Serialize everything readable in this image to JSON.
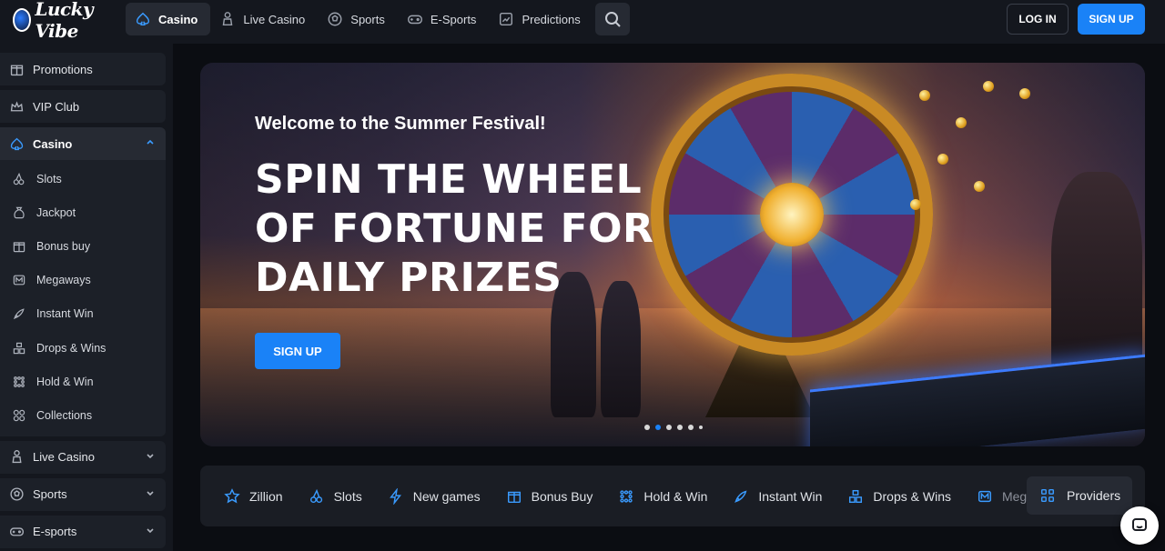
{
  "brand": {
    "logo_text": "Lucky Vibe"
  },
  "nav": {
    "items": [
      {
        "label": "Casino",
        "icon": "spade-icon",
        "active": true
      },
      {
        "label": "Live Casino",
        "icon": "dealer-icon",
        "active": false
      },
      {
        "label": "Sports",
        "icon": "soccer-ball-icon",
        "active": false
      },
      {
        "label": "E-Sports",
        "icon": "gamepad-icon",
        "active": false
      },
      {
        "label": "Predictions",
        "icon": "trend-chart-icon",
        "active": false
      }
    ],
    "search_icon": "search-icon"
  },
  "auth": {
    "login_label": "LOG IN",
    "signup_label": "SIGN UP"
  },
  "sidebar": {
    "items_top": [
      {
        "label": "Promotions",
        "icon": "gift-icon"
      },
      {
        "label": "VIP Club",
        "icon": "crown-icon"
      }
    ],
    "casino": {
      "label": "Casino",
      "icon": "spade-icon",
      "expanded": true,
      "sub_items": [
        {
          "label": "Slots",
          "icon": "cherries-icon"
        },
        {
          "label": "Jackpot",
          "icon": "money-bag-icon"
        },
        {
          "label": "Bonus buy",
          "icon": "gift-box-icon"
        },
        {
          "label": "Megaways",
          "icon": "megaways-icon"
        },
        {
          "label": "Instant Win",
          "icon": "rocket-icon"
        },
        {
          "label": "Drops & Wins",
          "icon": "stack-icon"
        },
        {
          "label": "Hold & Win",
          "icon": "grid-dots-icon"
        },
        {
          "label": "Collections",
          "icon": "collections-icon"
        }
      ]
    },
    "items_bottom": [
      {
        "label": "Live Casino",
        "icon": "dealer-icon"
      },
      {
        "label": "Sports",
        "icon": "soccer-ball-icon"
      },
      {
        "label": "E-sports",
        "icon": "gamepad-icon"
      }
    ]
  },
  "banner": {
    "subtitle": "Welcome to the Summer Festival!",
    "title": "SPIN THE WHEEL OF FORTUNE FOR DAILY PRIZES",
    "button_label": "SIGN UP",
    "slides_total": 6,
    "active_slide": 2
  },
  "categories": {
    "items": [
      {
        "label": "Zillion",
        "icon": "star-icon"
      },
      {
        "label": "Slots",
        "icon": "cherries-icon"
      },
      {
        "label": "New games",
        "icon": "lightning-icon"
      },
      {
        "label": "Bonus Buy",
        "icon": "gift-box-icon"
      },
      {
        "label": "Hold & Win",
        "icon": "grid-dots-icon"
      },
      {
        "label": "Instant Win",
        "icon": "rocket-icon"
      },
      {
        "label": "Drops & Wins",
        "icon": "stack-icon"
      },
      {
        "label": "Mega",
        "icon": "megaways-icon"
      }
    ],
    "providers_label": "Providers",
    "providers_icon": "providers-grid-icon"
  },
  "chat": {
    "icon": "chat-icon"
  },
  "colors": {
    "accent": "#1a82f7",
    "topbar": "#14171e",
    "page": "#0b0d12"
  }
}
